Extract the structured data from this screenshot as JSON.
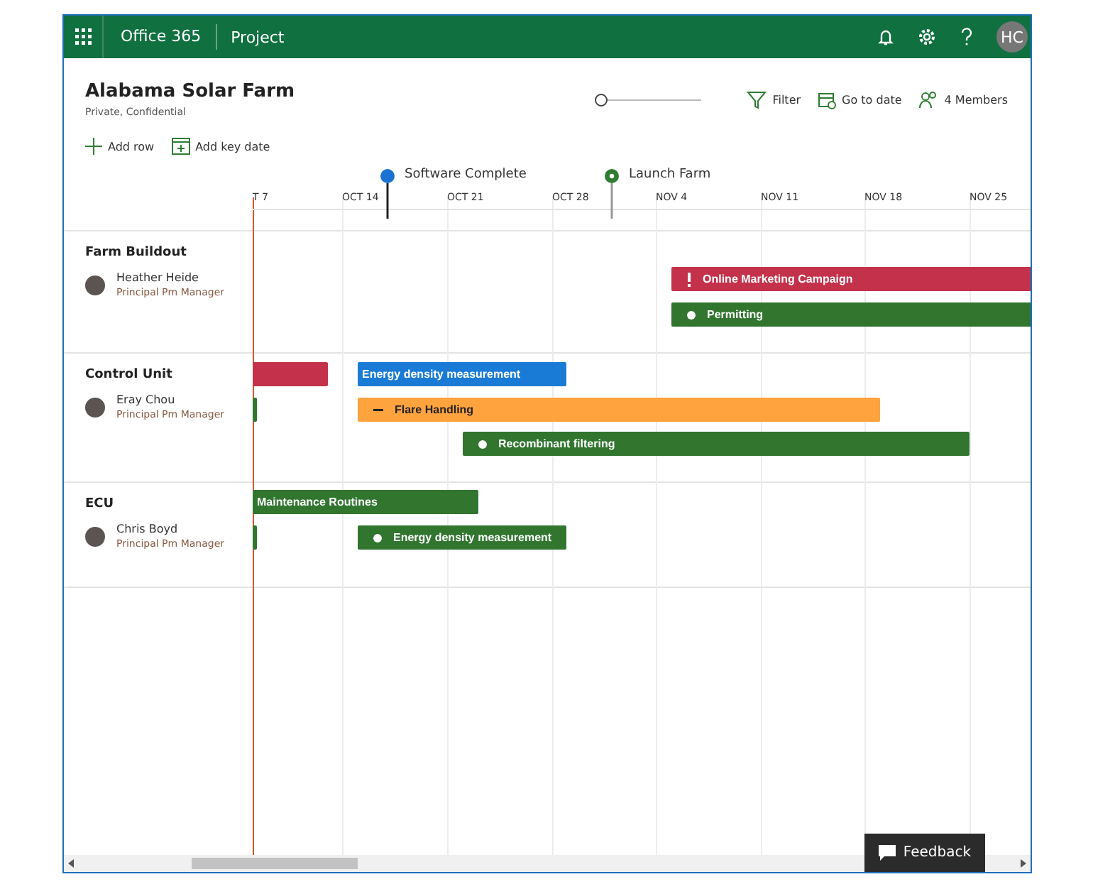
{
  "app_bar": {
    "suite": "Office 365",
    "app": "Project",
    "avatar": "HC"
  },
  "project": {
    "title": "Alabama Solar Farm",
    "subtitle": "Private, Confidential"
  },
  "toolbar": {
    "zoom": {
      "level": 0
    },
    "filter": "Filter",
    "go_to_date": "Go to date",
    "members": "4 Members",
    "add_row": "Add row",
    "add_key_date": "Add key date"
  },
  "key_dates": [
    {
      "label": "Software Complete",
      "kind": "filled",
      "color": "#1a73d1"
    },
    {
      "label": "Launch Farm",
      "kind": "dotted",
      "color": "#2e7d32"
    }
  ],
  "dates": [
    "T 7",
    "OCT 14",
    "OCT 21",
    "OCT 28",
    "NOV 4",
    "NOV 11",
    "NOV 18",
    "NOV 25"
  ],
  "rows": [
    {
      "name": "Farm Buildout",
      "owner": "Heather Heide",
      "role": "Principal Pm Manager",
      "tasks": [
        {
          "label": "Online Marketing Campaign",
          "kind": "alert",
          "color": "#c4314b"
        },
        {
          "label": "Permitting",
          "kind": "dot",
          "color": "#31752f"
        }
      ]
    },
    {
      "name": "Control Unit",
      "owner": "Eray Chou",
      "role": "Principal Pm Manager",
      "tasks": [
        {
          "kind": "plain",
          "color": "#c4314b"
        },
        {
          "label": "Energy density measurement",
          "kind": "plain",
          "color": "#1a7bd6"
        },
        {
          "kind": "plain",
          "color": "#31752f"
        },
        {
          "label": "Flare Handling",
          "kind": "dash",
          "color": "#ffa33f"
        },
        {
          "label": "Recombinant filtering",
          "kind": "dot",
          "color": "#31752f"
        }
      ]
    },
    {
      "name": "ECU",
      "owner": "Chris Boyd",
      "role": "Principal Pm Manager",
      "tasks": [
        {
          "label": "Maintenance Routines",
          "kind": "plain",
          "color": "#31752f"
        },
        {
          "kind": "plain",
          "color": "#31752f"
        },
        {
          "label": "Energy density measurement",
          "kind": "dot",
          "color": "#31752f"
        }
      ]
    }
  ],
  "feedback": "Feedback"
}
